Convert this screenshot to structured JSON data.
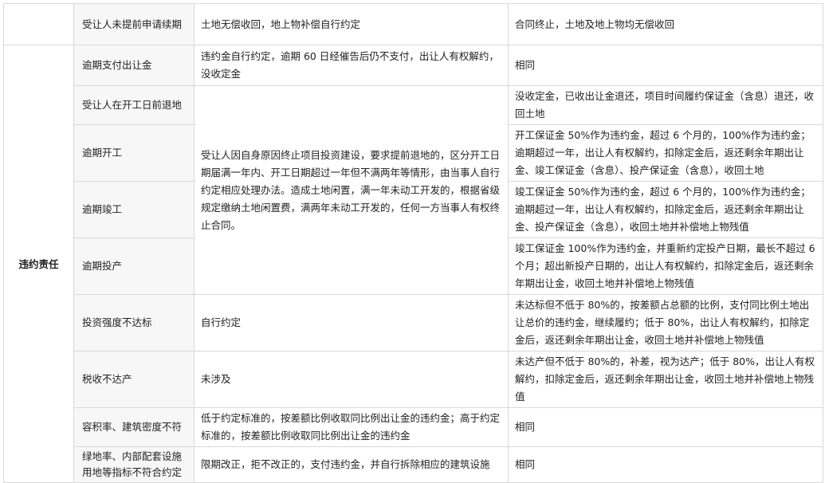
{
  "rows": [
    {
      "item": "受让人未提前申请续期",
      "c2": "土地无偿收回，地上物补偿自行约定",
      "c3": "合同终止，土地及地上物均无偿收回"
    },
    {
      "item": "逾期支付出让金",
      "c2": "违约金自行约定，逾期 60 日经催告后仍不支付，出让人有权解约，没收定金",
      "c3": "相同"
    },
    {
      "item": "受让人在开工日前退地",
      "c3": "没收定金，已收出让金退还，项目时间履约保证金（含息）退还，收回土地"
    },
    {
      "item": "逾期开工",
      "c3": "开工保证金 50%作为违约金，超过 6 个月的，100%作为违约金；逾期超过一年，出让人有权解约，扣除定金后，返还剩余年期出让金、竣工保证金（含息）、投产保证金（含息），收回土地"
    },
    {
      "item": "逾期竣工",
      "c3": "竣工保证金 50%作为违约金，超过 6 个月的，100%作为违约金；逾期超过一年，出让人有权解约，扣除定金后，返还剩余年期出让金、投产保证金（含息），收回土地并补偿地上物残值"
    },
    {
      "item": "逾期投产",
      "c3": "竣工保证金 100%作为违约金，并重新约定投产日期，最长不超过 6 个月；超出新投产日期的，出让人有权解约，扣除定金后，返还剩余年期出让金，收回土地并补偿地上物残值"
    },
    {
      "item": "投资强度不达标",
      "c2": "自行约定",
      "c3": "未达标但不低于 80%的，按差额占总额的比例，支付同比例土地出让总价的违约金，继续履约；低于 80%，出让人有权解约，扣除定金后，返还剩余年期出让金，收回土地并补偿地上物残值"
    },
    {
      "item": "税收不达产",
      "c2": "未涉及",
      "c3": "未达产但不低于 80%的，补差，视为达产；低于 80%，出让人有权解约，扣除定金后，返还剩余年期出让金，收回土地并补偿地上物残值"
    },
    {
      "item": "容积率、建筑密度不符",
      "c2": "低于约定标准的，按差额比例收取同比例出让金的违约金；高于约定标准的，按差额比例收取同比例出让金的违约金",
      "c3": "相同"
    },
    {
      "item": "绿地率、内部配套设施用地等指标不符合约定",
      "c2": "限期改正，拒不改正的，支付违约金，并自行拆除相应的建筑设施",
      "c3": "相同"
    }
  ],
  "merged_c2": "受让人因自身原因终止项目投资建设，要求提前退地的，区分开工日期届满一年内、开工日期超过一年但不满两年等情形，由当事人自行约定相应处理办法。造成土地闲置，满一年未动工开发的，根据省级规定缴纳土地闲置费，满两年未动工开发的，任何一方当事人有权终止合同。",
  "category": "违约责任"
}
